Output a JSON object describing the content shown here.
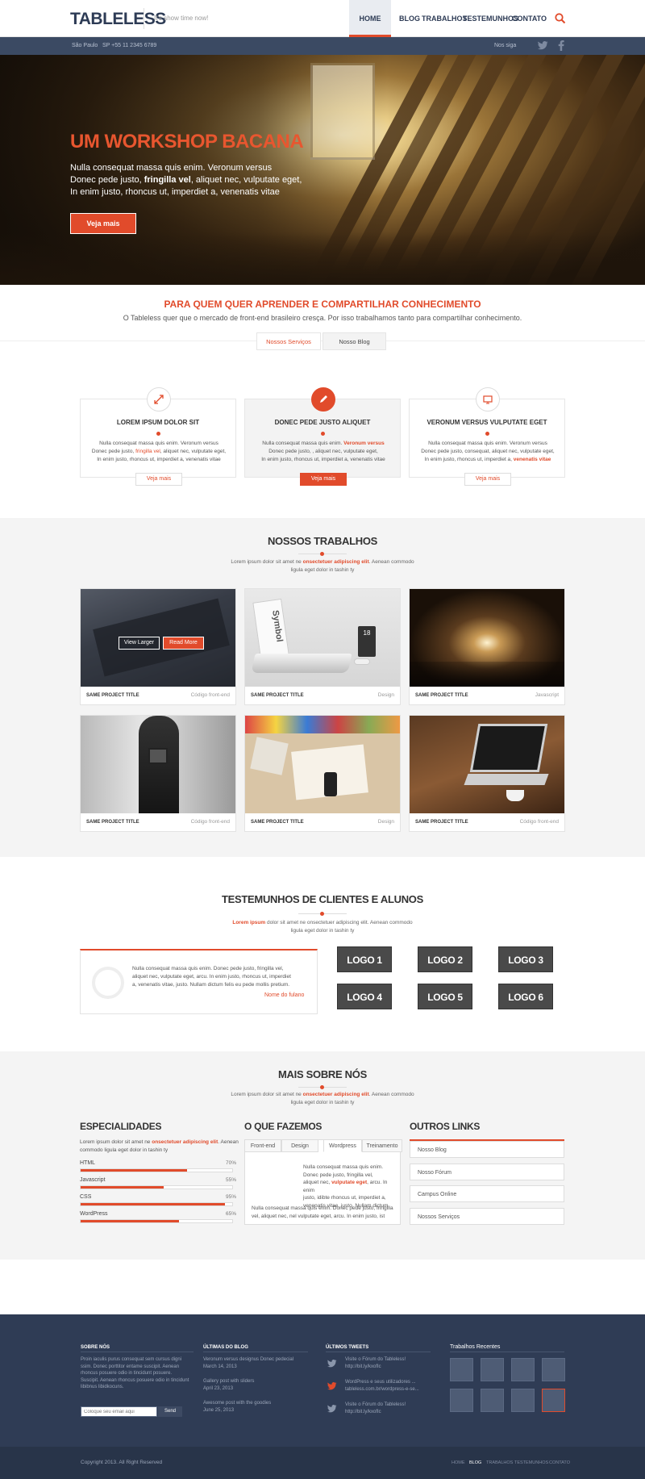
{
  "header": {
    "logo": "TABLELESS",
    "tagline": "It's show time now!",
    "nav": [
      "HOME",
      "BLOG",
      "TRABALHOS",
      "TESTEMUNHOS",
      "CONTATO"
    ]
  },
  "topbar": {
    "city": "São Paulo",
    "phone": "SP +55 11 2345 6789",
    "follow": "Nos siga"
  },
  "hero": {
    "title": "UM WORKSHOP BACANA",
    "line1": "Nulla consequat massa quis enim. Veronum versus",
    "line2_a": "Donec pede justo, ",
    "line2_b": "fringilla vel",
    "line2_c": ", aliquet nec, vulputate eget,",
    "line3": "In enim justo, rhoncus ut, imperdiet a, venenatis vitae",
    "button": "Veja mais"
  },
  "intro": {
    "title": "PARA QUEM QUER APRENDER E  COMPARTILHAR CONHECIMENTO",
    "text": "O Tableless quer que o mercado de front-end brasileiro cresça. Por isso trabalhamos tanto para compartilhar conhecimento.",
    "tab1": "Nossos Serviços",
    "tab2": "Nosso Blog"
  },
  "services": [
    {
      "title": "LOREM IPSUM DOLOR SIT",
      "l1": "Nulla consequat massa quis enim. Veronum versus",
      "l2a": "Donec pede justo, ",
      "l2b": "fringilla vel",
      "l2c": ", aliquet nec, vulputate eget,",
      "l3": "In enim justo, rhoncus ut, imperdiet a, venenatis vitae",
      "button": "Veja mais"
    },
    {
      "title": "DONEC PEDE JUSTO ALIQUET",
      "l1a": "Nulla consequat massa quis enim. ",
      "l1b": "Veronum versus",
      "l2": "Donec pede justo, , aliquet nec, vulputate eget,",
      "l3": "In enim justo, rhoncus ut, imperdiet a, venenatis vitae",
      "button": "Veja mais"
    },
    {
      "title": "VERONUM VERSUS VULPUTATE EGET",
      "l1": "Nulla consequat massa quis enim. Veronum versus",
      "l2": "Donec pede justo, consequat, aliquet nec, vulputate eget,",
      "l3a": "In enim justo, rhoncus ut, imperdiet a, ",
      "l3b": "venenatis vitae",
      "button": "Veja mais"
    }
  ],
  "portfolio": {
    "title": "NOSSOS TRABALHOS",
    "sub_a": "Lorem ipsum dolor sit amet ne ",
    "sub_b": "onsectetuer adipiscing elit",
    "sub_c": ". Aenean commodo",
    "sub_d": "ligula eget dolor in tashin ty",
    "view_larger": "View  Larger",
    "read_more": "Read More",
    "items": [
      {
        "title": "SAME PROJECT TITLE",
        "category": "Código front-end"
      },
      {
        "title": "SAME PROJECT TITLE",
        "category": "Design"
      },
      {
        "title": "SAME PROJECT TITLE",
        "category": "Javascript"
      },
      {
        "title": "SAME PROJECT TITLE",
        "category": "Código front-end"
      },
      {
        "title": "SAME PROJECT TITLE",
        "category": "Design"
      },
      {
        "title": "SAME PROJECT TITLE",
        "category": "Código front-end"
      }
    ],
    "img2_text": "Symbol",
    "img2_num": "18"
  },
  "testimonials": {
    "title": "TESTEMUNHOS DE CLIENTES E ALUNOS",
    "sub_a": "Lorem ipsum",
    "sub_b": " dolor sit amet ne onsectetuer adipiscing elit. Aenean commodo",
    "sub_c": "ligula eget dolor in tashin ty",
    "quote_1": "Nulla consequat massa quis enim. Donec pede justo, fringilla vel,",
    "quote_2": "aliquet nec, vulputate eget, arcu. In enim justo, rhoncus ut, imperdiet",
    "quote_3": "a, venenatis vitae, justo. Nullam dictum felis eu pede mollis pretium.",
    "author": "Nome do fulano",
    "logos": [
      "LOGO 1",
      "LOGO 2",
      "LOGO 3",
      "LOGO 4",
      "LOGO 5",
      "LOGO 6"
    ]
  },
  "mais": {
    "title": "MAIS SOBRE NÓS",
    "sub_a": "Lorem ipsum dolor sit amet ne ",
    "sub_b": "onsectetuer adipiscing elit",
    "sub_c": ". Aenean commodo",
    "sub_d": "ligula eget dolor in tashin ty",
    "especialidades": {
      "title": "ESPECIALIDADES",
      "text_a": "Lorem ipsum dolor sit amet ne ",
      "text_b": "onsectetuer adipiscing elit",
      "text_c": ". Aenean",
      "text_d": "commodo ligula eget dolor in tashin ty",
      "skills": [
        {
          "name": "HTML",
          "label": "70%",
          "value": 0.7
        },
        {
          "name": "Javascript",
          "label": "55%",
          "value": 0.55
        },
        {
          "name": "CSS",
          "label": "95%",
          "value": 0.95
        },
        {
          "name": "WordPress",
          "label": "65%",
          "value": 0.65
        }
      ]
    },
    "oquefazemos": {
      "title": "O QUE FAZEMOS",
      "tabs": [
        "Front-end",
        "Design",
        "Wordpress",
        "Treinamento"
      ],
      "p1": "Nulla consequat massa quis enim.",
      "p2": "Donec pede justo, fringilla vel,",
      "p3a": "aliquet nec, ",
      "p3b": "vulputate eget",
      "p3c": ", arcu. In enim",
      "p4": "justo, idibte rhoncus ut, imperdiet a,",
      "p5": "venenatis vitae, justo. Nullam dictum",
      "p6": "Nulla consequat massa quis enim. Donec pede justo, fringilla",
      "p7": "vel, aliquet nec, nel vulputate eget, arcu. In enim justo, ist"
    },
    "outros": {
      "title": "OUTROS LINKS",
      "links": [
        "Nosso Blog",
        "Nosso Fórum",
        "Campus Online",
        "Nossos Serviços"
      ]
    }
  },
  "footer": {
    "sobre_title": "Sobre nós",
    "sobre_text": [
      "Proin iaculis purus consequat sem cursus digni",
      "ssim. Donec porttitor entame suscipit. Aenean",
      "rhoncus posuere odio in tincidunt posuere.",
      "Suscipit. Aenean rhoncus posuere odio in tincidunt",
      "libibnus libidkocuns."
    ],
    "email_placeholder": "Coloque seu email aqui",
    "send": "Send",
    "blog_title": "Últimas do Blog",
    "blog": [
      {
        "title": "Veronum versus designus Donec pedecial",
        "date": "March 14, 2013"
      },
      {
        "title": "Gallery post with sliders",
        "date": "April 23, 2013"
      },
      {
        "title": "Awesome post with the goodies",
        "date": "June 25, 2013"
      }
    ],
    "tweets_title": "Últimos Tweets",
    "tweets": [
      {
        "l1": "Visite o Fórum do Tableless!",
        "l2": "http://bit.ly/kxofIc"
      },
      {
        "l1": "WordPress e seus utilizadores ...",
        "l2": "tableless.com.br/wordpress-e-se..."
      },
      {
        "l1": "Visite o Fórum do Tableless!",
        "l2": "http://bit.ly/kxofIc"
      }
    ],
    "recent_title": "Trabalhos Recentes",
    "copyright": "Copyright 2013. All Right Reserved",
    "nav": [
      "HOME",
      "BLOG",
      "TRABALHOS",
      "TESTEMUNHOS",
      "CONTATO"
    ]
  },
  "colors": {
    "accent": "#e14b2b",
    "navy": "#2f3c55",
    "light_bg": "#f4f4f4"
  }
}
